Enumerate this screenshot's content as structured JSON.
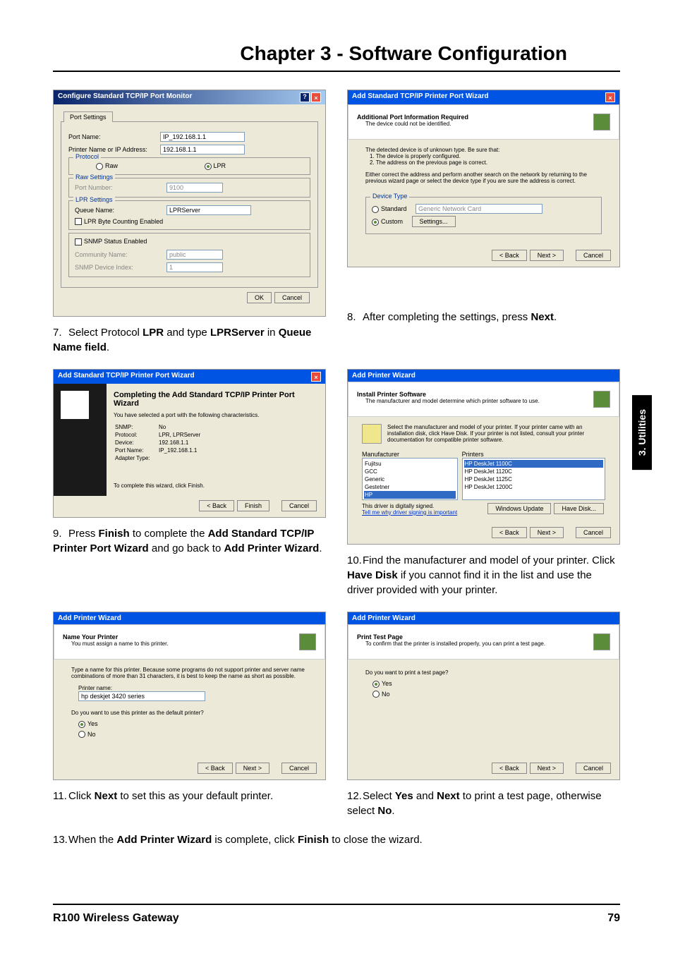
{
  "chapter": "Chapter 3 - Software Configuration",
  "side_tab": "3. Utilities",
  "footer": {
    "product": "R100 Wireless Gateway",
    "page": "79"
  },
  "d1": {
    "title": "Configure Standard TCP/IP Port Monitor",
    "tab": "Port Settings",
    "portname_l": "Port Name:",
    "portname_v": "IP_192.168.1.1",
    "printer_l": "Printer Name or IP Address:",
    "printer_v": "192.168.1.1",
    "protocol": "Protocol",
    "raw": "Raw",
    "lpr": "LPR",
    "rawset": "Raw Settings",
    "portnum_l": "Port Number:",
    "portnum_v": "9100",
    "lprset": "LPR Settings",
    "queue_l": "Queue Name:",
    "queue_v": "LPRServer",
    "lprbyte": "LPR Byte Counting Enabled",
    "snmp": "SNMP Status Enabled",
    "comm_l": "Community Name:",
    "comm_v": "public",
    "idx_l": "SNMP Device Index:",
    "idx_v": "1",
    "ok": "OK",
    "cancel": "Cancel"
  },
  "d2": {
    "title": "Add Standard TCP/IP Printer Port Wizard",
    "h1": "Additional Port Information Required",
    "h2": "The device could not be identified.",
    "t1": "The detected device is of unknown type. Be sure that:",
    "t2": "1. The device is properly configured.",
    "t3": "2. The address on the previous page is correct.",
    "t4": "Either correct the address and perform another search on the network by returning to the previous wizard page or select the device type if you are sure the address is correct.",
    "devtype": "Device Type",
    "std": "Standard",
    "std_v": "Generic Network Card",
    "custom": "Custom",
    "settings": "Settings...",
    "back": "< Back",
    "next": "Next >",
    "cancel": "Cancel"
  },
  "s7": "Select Protocol ",
  "s7b1": "LPR",
  "s7_2": " and type ",
  "s7b2": "LPRServer",
  "s7_3": " in ",
  "s7b3": "Queue Name field",
  "s7_4": ".",
  "s8": "After completing the settings, press ",
  "s8b": "Next",
  "s8_2": ".",
  "d3": {
    "title": "Add Standard TCP/IP Printer Port Wizard",
    "h1": "Completing the Add Standard TCP/IP Printer Port Wizard",
    "h2": "You have selected a port with the following characteristics.",
    "snmp": "SNMP:",
    "snmp_v": "No",
    "proto": "Protocol:",
    "proto_v": "LPR, LPRServer",
    "dev": "Device:",
    "dev_v": "192.168.1.1",
    "portn": "Port Name:",
    "portn_v": "IP_192.168.1.1",
    "adapt": "Adapter Type:",
    "foot": "To complete this wizard, click Finish.",
    "back": "< Back",
    "finish": "Finish",
    "cancel": "Cancel"
  },
  "d4": {
    "title": "Add Printer Wizard",
    "h1": "Install Printer Software",
    "h2": "The manufacturer and model determine which printer software to use.",
    "t1": "Select the manufacturer and model of your printer. If your printer came with an installation disk, click Have Disk. If your printer is not listed, consult your printer documentation for compatible printer software.",
    "mfr": "Manufacturer",
    "prn": "Printers",
    "mfrs": [
      "Fujitsu",
      "GCC",
      "Generic",
      "Gestetner",
      "HP"
    ],
    "prns": [
      "HP DeskJet 1100C",
      "HP DeskJet 1120C",
      "HP DeskJet 1125C",
      "HP DeskJet 1200C"
    ],
    "signed": "This driver is digitally signed.",
    "tell": "Tell me why driver signing is important",
    "winup": "Windows Update",
    "havedisk": "Have Disk...",
    "back": "< Back",
    "next": "Next >",
    "cancel": "Cancel"
  },
  "s9": "Press ",
  "s9b1": "Finish",
  "s9_2": " to complete the ",
  "s9b2": "Add Standard TCP/IP Printer Port Wizard",
  "s9_3": " and go back to ",
  "s9b3": "Add Printer Wizard",
  "s9_4": ".",
  "s10": "Find the manufacturer and model of your printer. Click ",
  "s10b": "Have Disk",
  "s10_2": " if you cannot find it in the list and use the driver provided with your printer.",
  "d5": {
    "title": "Add Printer Wizard",
    "h1": "Name Your Printer",
    "h2": "You must assign a name to this printer.",
    "t1": "Type a name for this printer. Because some programs do not support printer and server name combinations of more than 31 characters, it is best to keep the name as short as possible.",
    "pname_l": "Printer name:",
    "pname_v": "hp deskjet 3420 series",
    "q": "Do you want to use this printer as the default printer?",
    "yes": "Yes",
    "no": "No",
    "back": "< Back",
    "next": "Next >",
    "cancel": "Cancel"
  },
  "d6": {
    "title": "Add Printer Wizard",
    "h1": "Print Test Page",
    "h2": "To confirm that the printer is installed properly, you can print a test page.",
    "q": "Do you want to print a test page?",
    "yes": "Yes",
    "no": "No",
    "back": "< Back",
    "next": "Next >",
    "cancel": "Cancel"
  },
  "s11": "Click ",
  "s11b": "Next",
  "s11_2": " to set this as your default printer.",
  "s12": "Select ",
  "s12b1": "Yes",
  "s12_2": " and ",
  "s12b2": "Next",
  "s12_3": " to print a test page, otherwise select ",
  "s12b3": "No",
  "s12_4": ".",
  "s13": "When the ",
  "s13b1": "Add Printer Wizard",
  "s13_2": " is complete, click ",
  "s13b2": "Finish",
  "s13_3": " to close the wizard."
}
